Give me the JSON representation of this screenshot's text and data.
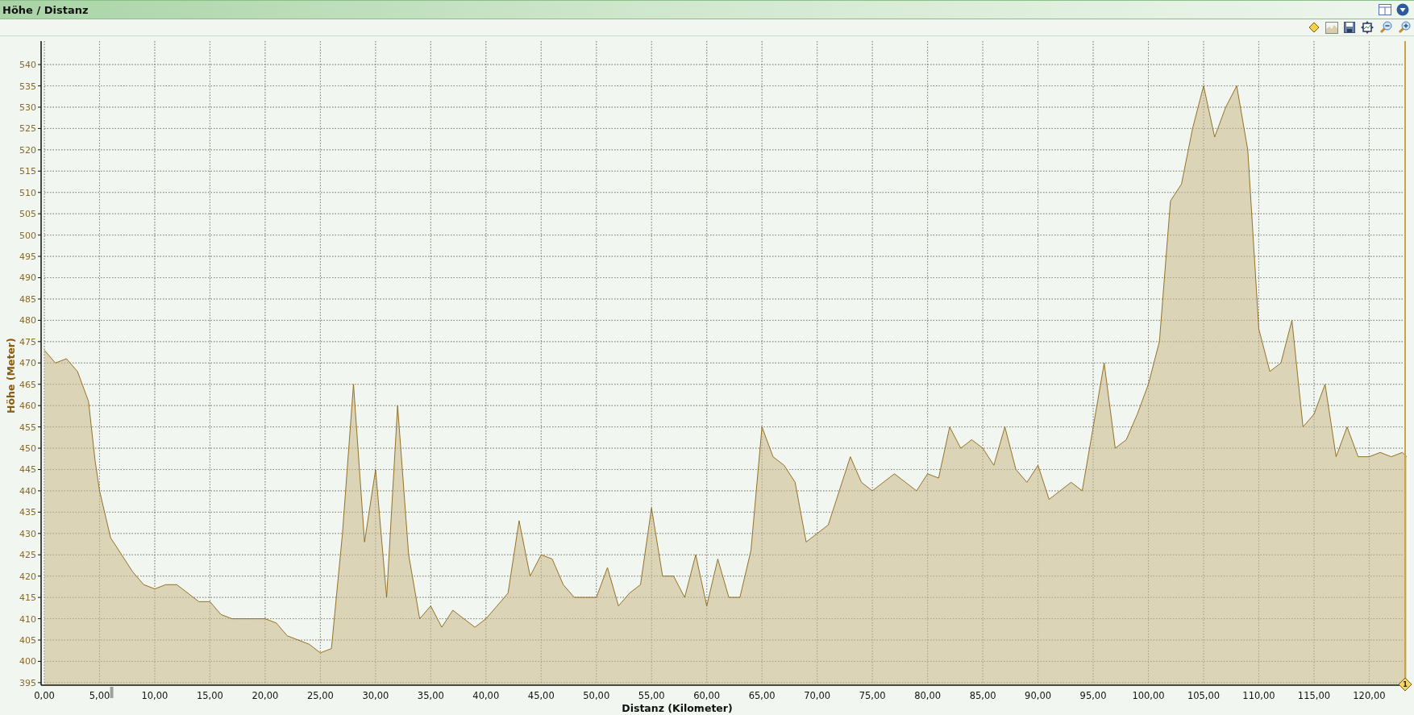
{
  "panel": {
    "title": "Höhe / Distanz"
  },
  "chart": {
    "chart_data": {
      "type": "area",
      "grid": true,
      "xlabel": "Distanz (Kilometer)",
      "ylabel": "Höhe (Meter)",
      "xlim": [
        0,
        123.4
      ],
      "ylim": [
        394.6,
        545.5
      ],
      "x": [
        0,
        1,
        2,
        3,
        4,
        4.6,
        5,
        6,
        7,
        8,
        9,
        10,
        11,
        12,
        13,
        14,
        15,
        16,
        17,
        18,
        19,
        20,
        21,
        22,
        23,
        24,
        25,
        26,
        27,
        28,
        29,
        30,
        31,
        32,
        33,
        34,
        35,
        36,
        37,
        38,
        39,
        40,
        41,
        42,
        43,
        44,
        45,
        46,
        47,
        48,
        49,
        50,
        51,
        52,
        53,
        54,
        55,
        56,
        57,
        58,
        59,
        60,
        61,
        62,
        63,
        64,
        65,
        66,
        67,
        68,
        69,
        70,
        71,
        72,
        73,
        74,
        75,
        76,
        77,
        78,
        79,
        80,
        81,
        82,
        83,
        84,
        85,
        86,
        87,
        88,
        89,
        90,
        91,
        92,
        93,
        94,
        95,
        96,
        97,
        98,
        99,
        100,
        101,
        102,
        103,
        104,
        105,
        106,
        107,
        108,
        109,
        110,
        111,
        112,
        113,
        114,
        115,
        116,
        117,
        118,
        119,
        120,
        121,
        122,
        123,
        123.4
      ],
      "values": [
        473,
        470,
        471,
        468,
        461,
        447,
        440,
        429,
        425,
        421,
        418,
        417,
        418,
        418,
        416,
        414,
        414,
        411,
        410,
        410,
        410,
        410,
        409,
        406,
        405,
        404,
        402,
        403,
        430,
        465,
        428,
        445,
        415,
        460,
        425,
        410,
        413,
        408,
        412,
        410,
        408,
        410,
        413,
        416,
        433,
        420,
        425,
        424,
        418,
        415,
        415,
        415,
        422,
        413,
        416,
        418,
        436,
        420,
        420,
        415,
        425,
        413,
        424,
        415,
        415,
        426,
        455,
        448,
        446,
        442,
        428,
        430,
        432,
        440,
        448,
        442,
        440,
        442,
        444,
        442,
        440,
        444,
        443,
        455,
        450,
        452,
        450,
        446,
        455,
        445,
        442,
        446,
        438,
        440,
        442,
        440,
        455,
        470,
        450,
        452,
        458,
        465,
        475,
        508,
        512,
        525,
        535,
        523,
        530,
        535,
        520,
        478,
        468,
        470,
        480,
        455,
        458,
        465,
        448,
        455,
        448,
        448,
        449,
        448,
        449,
        448
      ],
      "xticks": [
        {
          "value": 0,
          "label": "0,00"
        },
        {
          "value": 5,
          "label": "5,00"
        },
        {
          "value": 10,
          "label": "10,00"
        },
        {
          "value": 15,
          "label": "15,00"
        },
        {
          "value": 20,
          "label": "20,00"
        },
        {
          "value": 25,
          "label": "25,00"
        },
        {
          "value": 30,
          "label": "30,00"
        },
        {
          "value": 35,
          "label": "35,00"
        },
        {
          "value": 40,
          "label": "40,00"
        },
        {
          "value": 45,
          "label": "45,00"
        },
        {
          "value": 50,
          "label": "50,00"
        },
        {
          "value": 55,
          "label": "55,00"
        },
        {
          "value": 60,
          "label": "60,00"
        },
        {
          "value": 65,
          "label": "65,00"
        },
        {
          "value": 70,
          "label": "70,00"
        },
        {
          "value": 75,
          "label": "75,00"
        },
        {
          "value": 80,
          "label": "80,00"
        },
        {
          "value": 85,
          "label": "85,00"
        },
        {
          "value": 90,
          "label": "90,00"
        },
        {
          "value": 95,
          "label": "95,00"
        },
        {
          "value": 100,
          "label": "100,00"
        },
        {
          "value": 105,
          "label": "105,00"
        },
        {
          "value": 110,
          "label": "110,00"
        },
        {
          "value": 115,
          "label": "115,00"
        },
        {
          "value": 120,
          "label": "120,00"
        }
      ],
      "yticks": [
        395,
        400,
        405,
        410,
        415,
        420,
        425,
        430,
        435,
        440,
        445,
        450,
        455,
        460,
        465,
        470,
        475,
        480,
        485,
        490,
        495,
        500,
        505,
        510,
        515,
        520,
        525,
        530,
        535,
        540
      ]
    },
    "marker": {
      "label": "1"
    }
  }
}
